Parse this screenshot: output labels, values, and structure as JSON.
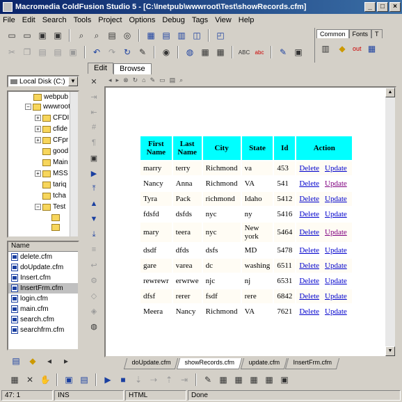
{
  "window": {
    "title": "Macromedia ColdFusion Studio 5 - [C:\\Inetpub\\wwwroot\\Test\\showRecords.cfm]"
  },
  "menu": [
    "File",
    "Edit",
    "Search",
    "Tools",
    "Project",
    "Options",
    "Debug",
    "Tags",
    "View",
    "Help"
  ],
  "right_tabs": [
    "Common",
    "Fonts",
    "T"
  ],
  "drive": "Local Disk (C:)",
  "tree": [
    "webpub",
    "wwwroot",
    "CFDI",
    "cfide",
    "CFpr",
    "good",
    "Main",
    "MSS",
    "tariq",
    "tcha",
    "Test"
  ],
  "file_list": {
    "header": "Name",
    "items": [
      "delete.cfm",
      "doUpdate.cfm",
      "Insert.cfm",
      "InsertFrm.cfm",
      "login.cfm",
      "main.cfm",
      "search.cfm",
      "searchfrm.cfm"
    ]
  },
  "editor_tabs": [
    "Edit",
    "Browse"
  ],
  "table": {
    "headers": [
      "First Name",
      "Last Name",
      "City",
      "State",
      "Id",
      "Action"
    ],
    "rows": [
      {
        "first": "marry",
        "last": "terry",
        "city": "Richmond",
        "state": "va",
        "id": "453"
      },
      {
        "first": "Nancy",
        "last": "Anna",
        "city": "Richmond",
        "state": "VA",
        "id": "541"
      },
      {
        "first": "Tyra",
        "last": "Pack",
        "city": "richmond",
        "state": "Idaho",
        "id": "5412"
      },
      {
        "first": "fdsfd",
        "last": "dsfds",
        "city": "nyc",
        "state": "ny",
        "id": "5416"
      },
      {
        "first": "mary",
        "last": "teera",
        "city": "nyc",
        "state": "New york",
        "id": "5464"
      },
      {
        "first": "dsdf",
        "last": "dfds",
        "city": "dsfs",
        "state": "MD",
        "id": "5478"
      },
      {
        "first": "gare",
        "last": "varea",
        "city": "dc",
        "state": "washing",
        "id": "6511"
      },
      {
        "first": "rewrewr",
        "last": "erwrwe",
        "city": "njc",
        "state": "nj",
        "id": "6531"
      },
      {
        "first": "dfsf",
        "last": "rerer",
        "city": "fsdf",
        "state": "rere",
        "id": "6842"
      },
      {
        "first": "Meera",
        "last": "Nancy",
        "city": "Richmond",
        "state": "VA",
        "id": "7621"
      }
    ],
    "delete_label": "Delete",
    "update_label": "Update"
  },
  "doc_tabs": [
    "doUpdate.cfm",
    "showRecords.cfm",
    "update.cfm",
    "InsertFrm.cfm"
  ],
  "status": {
    "position": "47: 1",
    "mode": "INS",
    "type": "HTML",
    "state": "Done"
  },
  "toolbar_extra": {
    "out_label": "out"
  }
}
